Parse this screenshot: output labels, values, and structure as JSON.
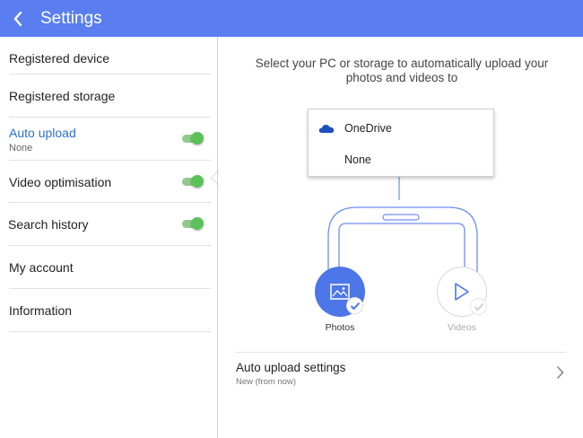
{
  "app": {
    "title": "Settings"
  },
  "sidebar": {
    "items": [
      {
        "label": "Registered device",
        "sub": "",
        "toggle": false
      },
      {
        "label": "Registered storage",
        "sub": "",
        "toggle": false
      },
      {
        "label": "Auto upload",
        "sub": "None",
        "toggle": true,
        "active": true
      },
      {
        "label": "Video optimisation",
        "sub": "",
        "toggle": true
      },
      {
        "label": "Search history",
        "sub": "",
        "toggle": true
      },
      {
        "label": "My account",
        "sub": "",
        "toggle": false
      },
      {
        "label": "Information",
        "sub": "",
        "toggle": false
      }
    ]
  },
  "main": {
    "description": "Select your PC or storage to automatically upload your photos and videos to",
    "dropdown": {
      "options": [
        {
          "label": "OneDrive",
          "icon": "onedrive-cloud-icon"
        },
        {
          "label": "None",
          "icon": ""
        }
      ]
    },
    "photos": {
      "label": "Photos",
      "icon": "image-icon",
      "checked": true
    },
    "videos": {
      "label": "Videos",
      "icon": "play-icon",
      "checked": false
    },
    "settings_row": {
      "title": "Auto upload settings",
      "subtitle": "New (from now)"
    }
  },
  "colors": {
    "appbar": "#5a7ef0",
    "active_text": "#2d6fd1",
    "toggle_on": "#5cc15a",
    "photos_circle": "#4d76e8"
  }
}
